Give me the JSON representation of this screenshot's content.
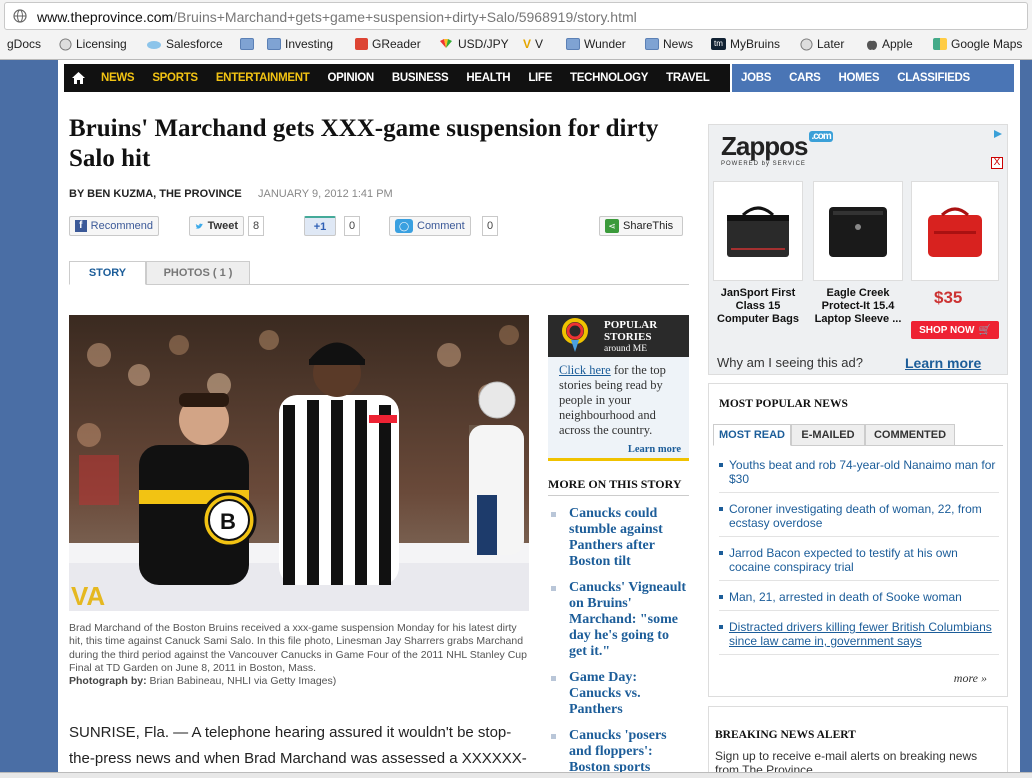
{
  "browser": {
    "url_domain": "www.theprovince.com",
    "url_path": "/Bruins+Marchand+gets+game+suspension+dirty+Salo/5968919/story.html",
    "bookmarks": [
      {
        "label": "gDocs",
        "icon": "none-icon"
      },
      {
        "label": "Licensing",
        "icon": "globe-icon"
      },
      {
        "label": "Salesforce",
        "icon": "cloud-icon"
      },
      {
        "label": "",
        "icon": "folder-icon"
      },
      {
        "label": "Investing",
        "icon": "folder-icon"
      },
      {
        "label": "GReader",
        "icon": "greader-icon"
      },
      {
        "label": "USD/JPY",
        "icon": "nbc-icon"
      },
      {
        "label": "V",
        "icon": "v-icon"
      },
      {
        "label": "Wunder",
        "icon": "folder-icon"
      },
      {
        "label": "News",
        "icon": "folder-icon"
      },
      {
        "label": "MyBruins",
        "icon": "tm-icon"
      },
      {
        "label": "Later",
        "icon": "globe-icon"
      },
      {
        "label": "Apple",
        "icon": "apple-icon"
      },
      {
        "label": "Google Maps",
        "icon": "maps-icon"
      }
    ]
  },
  "nav": {
    "primary": [
      "NEWS",
      "SPORTS",
      "ENTERTAINMENT",
      "OPINION",
      "BUSINESS",
      "HEALTH",
      "LIFE",
      "TECHNOLOGY",
      "TRAVEL"
    ],
    "secondary": [
      "JOBS",
      "CARS",
      "HOMES",
      "CLASSIFIEDS"
    ]
  },
  "article": {
    "headline": "Bruins' Marchand gets XXX-game suspension for dirty Salo hit",
    "byline": "BY BEN KUZMA, THE PROVINCE",
    "date": "JANUARY 9, 2012 1:41 PM",
    "share": {
      "recommend": "Recommend",
      "tweet": "Tweet",
      "tweet_count": "8",
      "plusone": "+1",
      "plusone_count": "0",
      "comment": "Comment",
      "comment_count": "0",
      "sharethis": "ShareThis"
    },
    "tabs": {
      "story": "STORY",
      "photos": "PHOTOS ( 1 )"
    },
    "caption": "Brad Marchand of the Boston Bruins received a xxx-game suspension Monday for his latest dirty hit, this time against Canuck Sami Salo. In this file photo, Linesman Jay Sharrers grabs Marchand during the third period against the Vancouver Canucks in Game Four of the 2011 NHL Stanley Cup Final at TD Garden on June 8, 2011 in Boston, Mass.",
    "photo_credit_label": "Photograph by:",
    "photo_credit": "Brian Babineau, NHLI via Getty Images)",
    "body": "SUNRISE, Fla. — A telephone hearing assured it wouldn't be stop-the-press news and when Brad Marchand was assessed a XXXXXX-game"
  },
  "popular_stories": {
    "title_line1": "POPULAR",
    "title_line2": "STORIES",
    "title_line3": "around ME",
    "link": "Click here",
    "text": " for the top stories being read by people in your neighbourhood and across the country.",
    "learn_more": "Learn more"
  },
  "more_on_story": {
    "heading": "MORE ON THIS STORY",
    "items": [
      "Canucks could stumble against Panthers after Boston tilt",
      "Canucks' Vigneault on Bruins' Marchand: \"some day he's going to get it.\"",
      "Game Day: Canucks vs. Panthers",
      "Canucks 'posers and floppers': Boston sports"
    ]
  },
  "ad": {
    "brand": "Zappos",
    "brand_badge": ".com",
    "powered": "POWERED by SERVICE",
    "products": [
      {
        "name": "JanSport First Class 15 Computer Bags"
      },
      {
        "name": "Eagle Creek Protect-It 15.4 Laptop Sleeve ..."
      }
    ],
    "price": "$35",
    "shop_now": "SHOP NOW",
    "why": "Why am I seeing this ad?",
    "learn_more": "Learn more",
    "close": "X"
  },
  "most_popular": {
    "heading": "MOST POPULAR NEWS",
    "tabs": [
      "MOST READ",
      "E-MAILED",
      "COMMENTED"
    ],
    "items": [
      "Youths beat and rob 74-year-old Nanaimo man for $30",
      "Coroner investigating death of woman, 22, from ecstasy overdose",
      "Jarrod Bacon expected to testify at his own cocaine conspiracy trial",
      "Man, 21, arrested in death of Sooke woman",
      "Distracted drivers killing fewer British Columbians since law came in, government says"
    ],
    "more": "more »"
  },
  "breaking": {
    "heading": "BREAKING NEWS ALERT",
    "text": "Sign up to receive e-mail alerts on breaking news from The Province."
  },
  "colors": {
    "nav_dark": "#111111",
    "nav_blue": "#4a75b5",
    "nav_highlight": "#f2c313",
    "link_blue": "#1c5d99",
    "page_bg": "#4a6ea5"
  }
}
